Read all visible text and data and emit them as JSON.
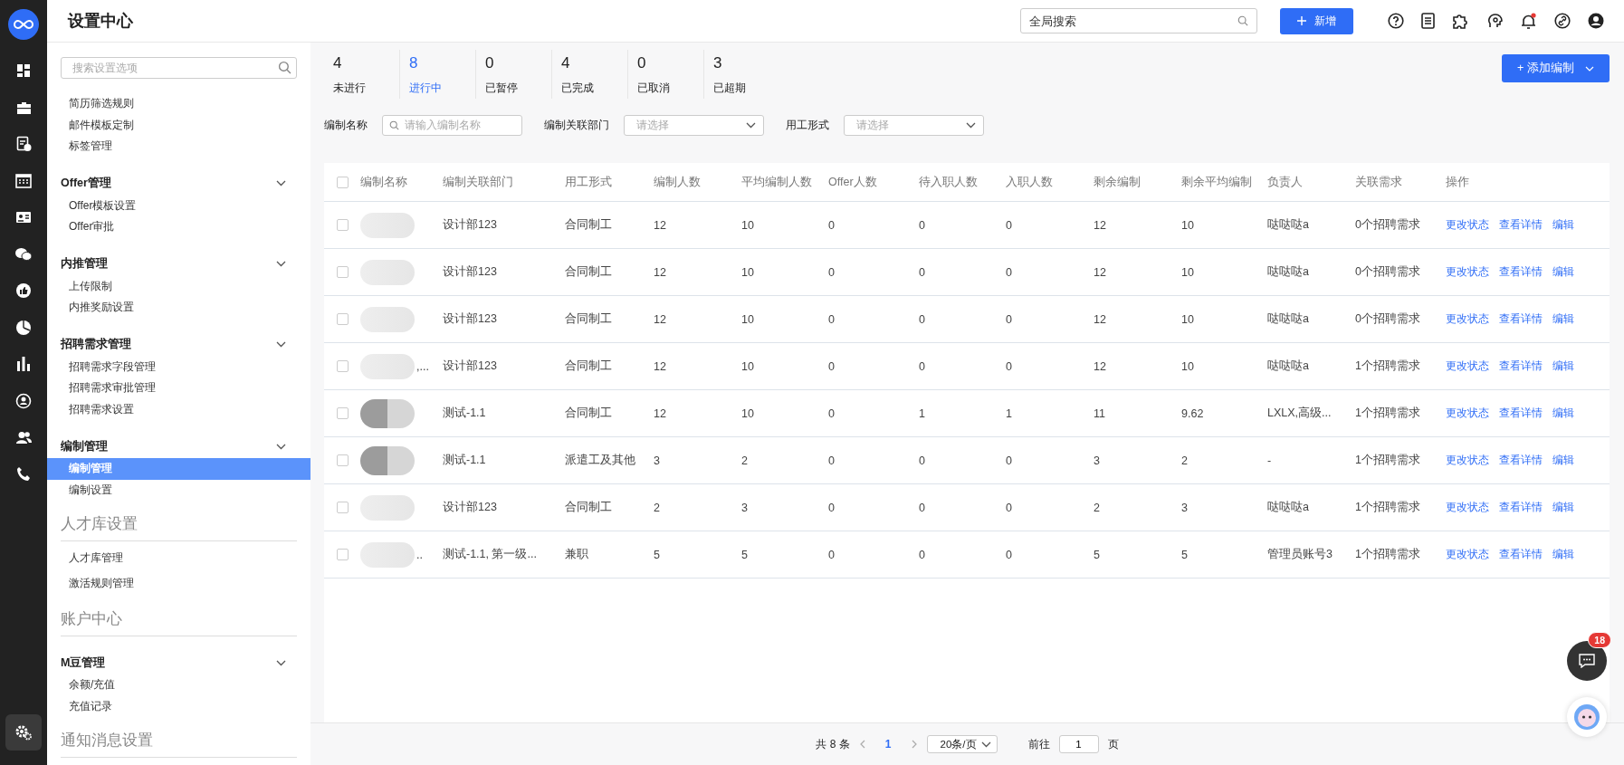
{
  "rail": {
    "items": [
      {
        "kind": "grid",
        "selected": false
      },
      {
        "kind": "briefcase",
        "selected": false
      },
      {
        "kind": "document",
        "selected": false
      },
      {
        "kind": "calendar",
        "selected": false
      },
      {
        "kind": "card",
        "selected": false
      },
      {
        "kind": "chat",
        "selected": false
      },
      {
        "kind": "thumb",
        "selected": false
      },
      {
        "kind": "pie",
        "selected": false
      },
      {
        "kind": "bars",
        "selected": false
      },
      {
        "kind": "person",
        "selected": false
      },
      {
        "kind": "people",
        "selected": false
      },
      {
        "kind": "phone",
        "selected": false
      }
    ],
    "bottom": {
      "kind": "gear",
      "selected": true
    }
  },
  "app_bar": {
    "title": "设置中心",
    "search_placeholder": "全局搜索",
    "new_button": "新增"
  },
  "sidebar": {
    "search_placeholder": "搜索设置选项",
    "groups": [
      {
        "kind": "list",
        "children": [
          {
            "label": "简历筛选规则",
            "selected": false
          },
          {
            "label": "邮件模板定制",
            "selected": false
          },
          {
            "label": "标签管理",
            "selected": false
          }
        ]
      },
      {
        "kind": "group",
        "title": "Offer管理",
        "expanded": true,
        "children": [
          {
            "label": "Offer模板设置",
            "selected": false
          },
          {
            "label": "Offer审批",
            "selected": false
          }
        ]
      },
      {
        "kind": "group",
        "title": "内推管理",
        "expanded": true,
        "children": [
          {
            "label": "上传限制",
            "selected": false
          },
          {
            "label": "内推奖励设置",
            "selected": false
          }
        ]
      },
      {
        "kind": "group",
        "title": "招聘需求管理",
        "expanded": true,
        "children": [
          {
            "label": "招聘需求字段管理",
            "selected": false
          },
          {
            "label": "招聘需求审批管理",
            "selected": false
          },
          {
            "label": "招聘需求设置",
            "selected": false
          }
        ]
      },
      {
        "kind": "group",
        "title": "编制管理",
        "expanded": true,
        "children": [
          {
            "label": "编制管理",
            "selected": true
          },
          {
            "label": "编制设置",
            "selected": false
          }
        ]
      },
      {
        "kind": "section",
        "title": "人才库设置",
        "children": [
          {
            "label": "人才库管理",
            "selected": false
          },
          {
            "label": "激活规则管理",
            "selected": false
          }
        ]
      },
      {
        "kind": "section",
        "title": "账户中心"
      },
      {
        "kind": "group",
        "title": "M豆管理",
        "expanded": true,
        "children": [
          {
            "label": "余额/充值",
            "selected": false
          },
          {
            "label": "充值记录",
            "selected": false
          }
        ]
      },
      {
        "kind": "section",
        "title": "通知消息设置"
      }
    ]
  },
  "stats": [
    {
      "count": "4",
      "label": "未进行",
      "selected": false
    },
    {
      "count": "8",
      "label": "进行中",
      "selected": true
    },
    {
      "count": "0",
      "label": "已暂停",
      "selected": false
    },
    {
      "count": "4",
      "label": "已完成",
      "selected": false
    },
    {
      "count": "0",
      "label": "已取消",
      "selected": false
    },
    {
      "count": "3",
      "label": "已超期",
      "selected": false
    }
  ],
  "add_button": "+ 添加编制",
  "filters": [
    {
      "label": "编制名称",
      "kind": "input",
      "placeholder": "请输入编制名称"
    },
    {
      "label": "编制关联部门",
      "kind": "select",
      "placeholder": "请选择"
    },
    {
      "label": "用工形式",
      "kind": "select",
      "placeholder": "请选择"
    }
  ],
  "table": {
    "all_checked": false,
    "columns": [
      "编制名称",
      "编制关联部门",
      "用工形式",
      "编制人数",
      "平均编制人数",
      "Offer人数",
      "待入职人数",
      "入职人数",
      "剩余编制",
      "剩余平均编制",
      "负责人",
      "关联需求",
      "操作"
    ],
    "rows": [
      {
        "checked": false,
        "kind": "light",
        "cells": [
          "",
          "设计部123",
          "合同制工",
          "12",
          "10",
          "0",
          "0",
          "0",
          "12",
          "10",
          "哒哒哒a",
          "0个招聘需求"
        ],
        "actions": [
          "更改状态",
          "查看详情",
          "编辑"
        ]
      },
      {
        "checked": false,
        "kind": "light",
        "cells": [
          "",
          "设计部123",
          "合同制工",
          "12",
          "10",
          "0",
          "0",
          "0",
          "12",
          "10",
          "哒哒哒a",
          "0个招聘需求"
        ],
        "actions": [
          "更改状态",
          "查看详情",
          "编辑"
        ]
      },
      {
        "checked": false,
        "kind": "light",
        "cells": [
          "",
          "设计部123",
          "合同制工",
          "12",
          "10",
          "0",
          "0",
          "0",
          "12",
          "10",
          "哒哒哒a",
          "0个招聘需求"
        ],
        "actions": [
          "更改状态",
          "查看详情",
          "编辑"
        ]
      },
      {
        "checked": false,
        "kind": "light",
        "cells": [
          ",...",
          "设计部123",
          "合同制工",
          "12",
          "10",
          "0",
          "0",
          "0",
          "12",
          "10",
          "哒哒哒a",
          "1个招聘需求"
        ],
        "actions": [
          "更改状态",
          "查看详情",
          "编辑"
        ]
      },
      {
        "checked": false,
        "kind": "dark",
        "cells": [
          "",
          "测试-1.1",
          "合同制工",
          "12",
          "10",
          "0",
          "1",
          "1",
          "11",
          "9.62",
          "LXLX,高级...",
          "1个招聘需求"
        ],
        "actions": [
          "更改状态",
          "查看详情",
          "编辑"
        ]
      },
      {
        "checked": false,
        "kind": "dark",
        "cells": [
          "",
          "测试-1.1",
          "派遣工及其他",
          "3",
          "2",
          "0",
          "0",
          "0",
          "3",
          "2",
          "-",
          "1个招聘需求"
        ],
        "actions": [
          "更改状态",
          "查看详情",
          "编辑"
        ]
      },
      {
        "checked": false,
        "kind": "light",
        "cells": [
          "",
          "设计部123",
          "合同制工",
          "2",
          "3",
          "0",
          "0",
          "0",
          "2",
          "3",
          "哒哒哒a",
          "1个招聘需求"
        ],
        "actions": [
          "更改状态",
          "查看详情",
          "编辑"
        ]
      },
      {
        "checked": false,
        "kind": "light",
        "cells": [
          "..",
          "测试-1.1, 第一级...",
          "兼职",
          "5",
          "5",
          "0",
          "0",
          "0",
          "5",
          "5",
          "管理员账号3",
          "1个招聘需求"
        ],
        "actions": [
          "更改状态",
          "查看详情",
          "编辑"
        ]
      }
    ]
  },
  "pagination": {
    "total": "共 8 条",
    "pages": [
      {
        "label": "1",
        "selected": true
      }
    ],
    "page_size": "20条/页",
    "goto_label": "前往",
    "goto_value": "1",
    "goto_suffix": "页"
  },
  "chat_badge": "18"
}
